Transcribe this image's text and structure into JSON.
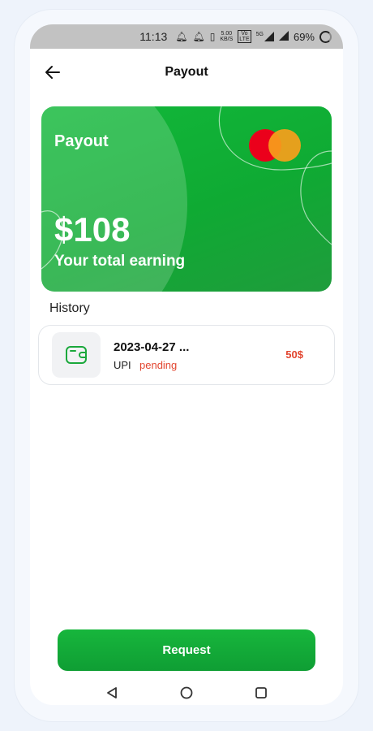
{
  "status_bar": {
    "time": "11:13",
    "net_speed_value": "5.00",
    "net_speed_unit": "KB/S",
    "volte_top": "Vo",
    "volte_bottom": "LTE",
    "network": "5G",
    "battery": "69%",
    "icons": [
      "bell-icon",
      "bell-icon",
      "vibrate-icon",
      "signal-icon",
      "signal-icon",
      "battery-icon"
    ]
  },
  "header": {
    "title": "Payout",
    "back_icon": "arrow-left-icon"
  },
  "card": {
    "title": "Payout",
    "amount": "$108",
    "subtitle": "Your total earning",
    "logo": "mastercard-logo",
    "colors": {
      "primary": "#12b83a",
      "mc_red": "#eb001b",
      "mc_orange": "#f79e1b"
    }
  },
  "history": {
    "label": "History",
    "items": [
      {
        "date": "2023-04-27 ...",
        "method": "UPI",
        "status": "pending",
        "amount": "50$",
        "icon": "wallet-icon"
      }
    ]
  },
  "actions": {
    "request_label": "Request"
  },
  "nav": {
    "icons": [
      "back-triangle-icon",
      "home-circle-icon",
      "recents-square-icon"
    ]
  },
  "theme": {
    "accent": "#0faa33",
    "danger": "#e2452f"
  }
}
